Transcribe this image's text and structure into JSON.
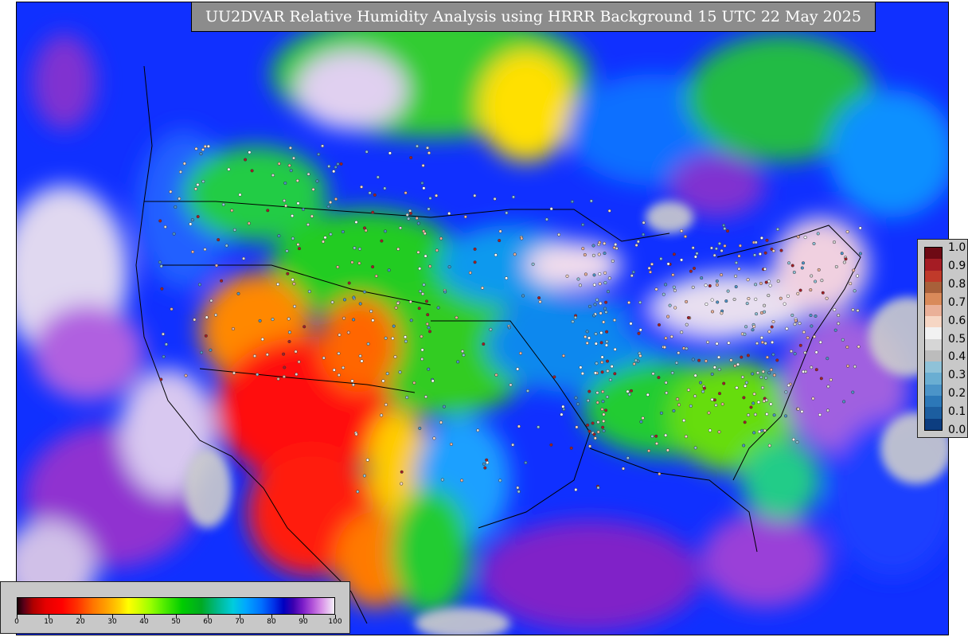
{
  "title": "UU2DVAR Relative Humidity Analysis using HRRR Background 15 UTC 22 May 2025",
  "map": {
    "regions": [
      {
        "name": "pacific-ocean",
        "color": "#1030ff"
      },
      {
        "name": "southwest-dry",
        "color": "#ff1010"
      },
      {
        "name": "plains",
        "color": "#22cc22"
      },
      {
        "name": "northeast",
        "color": "#e8e0f0"
      },
      {
        "name": "gulf-of-mexico",
        "color": "#7a20c8"
      },
      {
        "name": "atlantic-ocean",
        "color": "#0040f0"
      },
      {
        "name": "canada",
        "color": "#22bb44"
      }
    ],
    "station_markers": "small circles colored by observed relative humidity"
  },
  "colorbar_obs": {
    "labels": [
      "1.0",
      "0.9",
      "0.8",
      "0.7",
      "0.6",
      "0.5",
      "0.4",
      "0.3",
      "0.2",
      "0.1",
      "0.0"
    ],
    "colors": [
      "#6e0a14",
      "#a51c24",
      "#c03a2a",
      "#a8603a",
      "#d98a5a",
      "#eab098",
      "#f6d6c4",
      "#f2f2f2",
      "#d6d6d6",
      "#bcbcbc",
      "#8fc2d8",
      "#6aaed2",
      "#4b94c8",
      "#2c78b8",
      "#1c5ea0",
      "#0c3d80"
    ]
  },
  "colorbar_rh": {
    "labels": [
      "0",
      "10",
      "20",
      "30",
      "40",
      "50",
      "60",
      "70",
      "80",
      "90",
      "100"
    ]
  }
}
